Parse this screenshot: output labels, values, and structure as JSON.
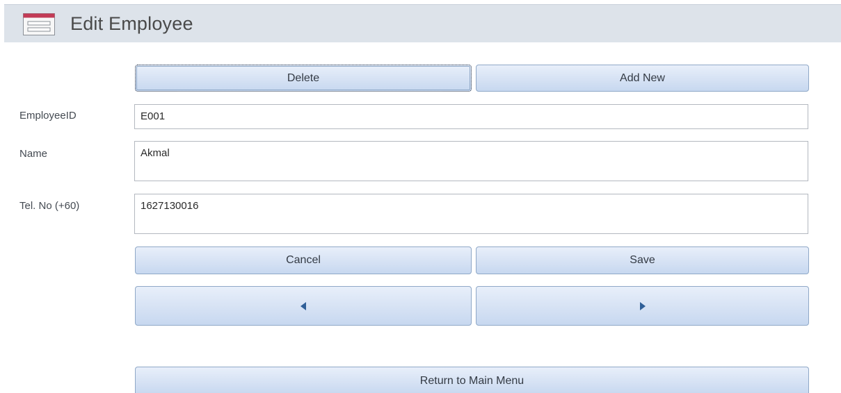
{
  "header": {
    "title": "Edit Employee",
    "icon": "form-icon"
  },
  "top_buttons": {
    "delete_label": "Delete",
    "add_new_label": "Add New"
  },
  "fields": {
    "employee_id": {
      "label": "EmployeeID",
      "value": "E001"
    },
    "name": {
      "label": "Name",
      "value": "Akmal"
    },
    "tel": {
      "label": "Tel. No (+60)",
      "value": "1627130016"
    }
  },
  "action_buttons": {
    "cancel_label": "Cancel",
    "save_label": "Save"
  },
  "nav_buttons": {
    "previous_icon": "triangle-left-icon",
    "next_icon": "triangle-right-icon"
  },
  "footer": {
    "return_label": "Return to Main Menu"
  },
  "colors": {
    "header_bg": "#dde3ea",
    "button_bg": "#d6e2f4",
    "button_border": "#8fa8c7",
    "arrow": "#2f5f98"
  }
}
